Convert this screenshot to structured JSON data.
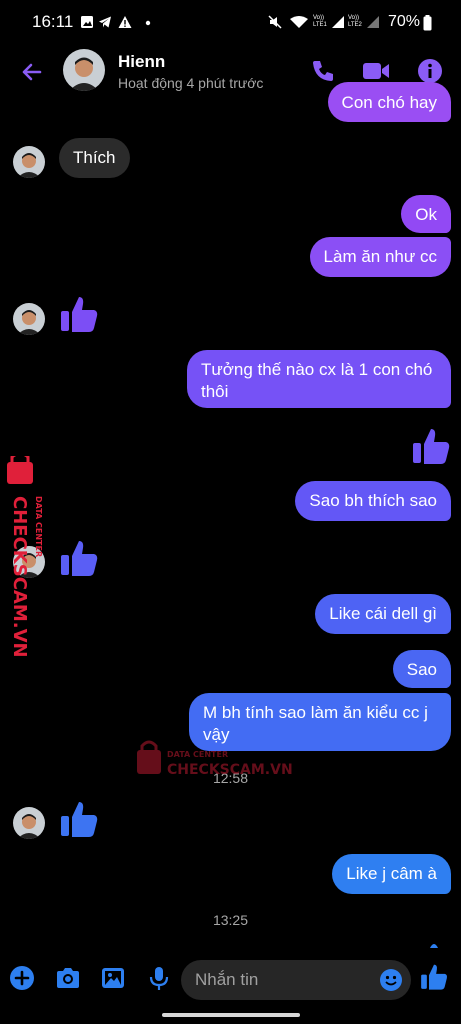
{
  "status_bar": {
    "time": "16:11",
    "battery": "70%",
    "lte1": "Vo)) LTE1",
    "lte2": "Vo)) LTE2"
  },
  "header": {
    "name": "Hienn",
    "status": "Hoạt động 4 phút trước"
  },
  "colors": {
    "accent": "#8a5cf5",
    "incoming": "#2b2b2b",
    "blue": "#2d7ff0"
  },
  "messages": {
    "m0": "Con chó hay",
    "m1": "Thích",
    "m2": "Ok",
    "m3": "Làm ăn như cc",
    "m4": "Tưởng thế nào cx là 1 con chó thôi",
    "m5": "Sao bh thích sao",
    "m6": "Like cái dell gì",
    "m7": "Sao",
    "m8": "M bh tính sao làm ăn kiểu cc j vậy",
    "m9": "Like j câm à"
  },
  "timestamps": {
    "t1": "12:58",
    "t2": "13:25"
  },
  "composer": {
    "placeholder": "Nhắn tin"
  },
  "watermark": {
    "brand": "CHECKSCAM.VN",
    "sub": "DATA CENTER"
  }
}
